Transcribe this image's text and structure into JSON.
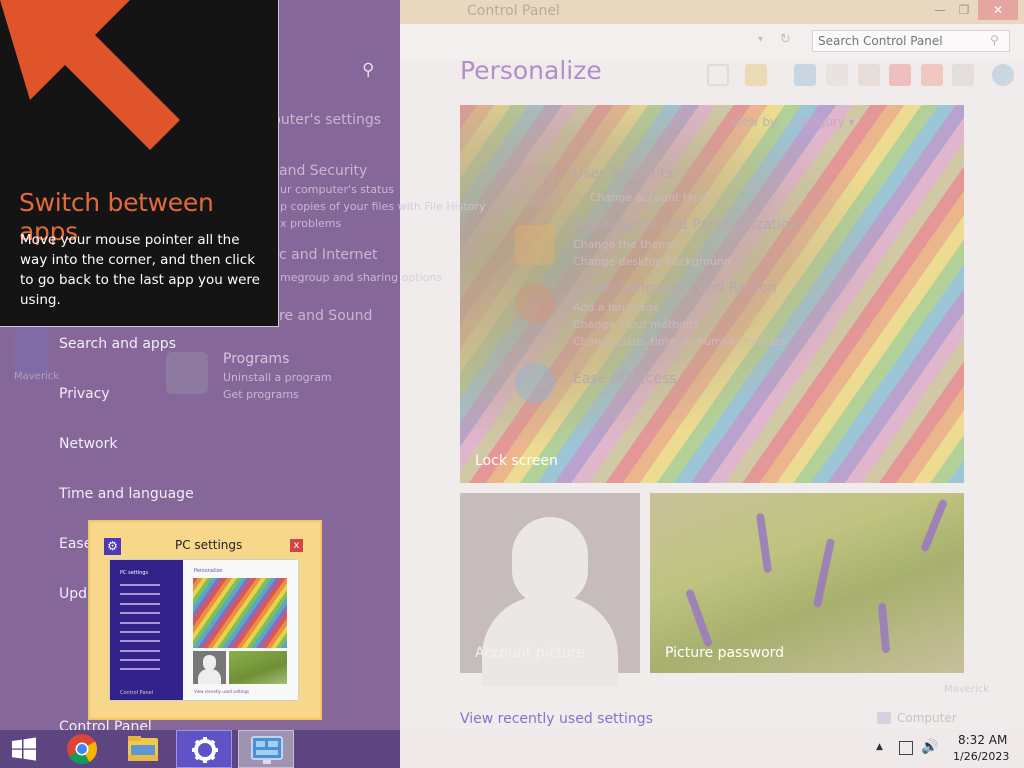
{
  "control_panel": {
    "title": "Control Panel",
    "min_label": "—",
    "max_label": "❐",
    "close_label": "✕",
    "search_placeholder": "Search Control Panel",
    "view_by_label": "View by:",
    "view_by_value": "Category ▾",
    "categories": [
      {
        "title": "User Accounts",
        "subs": [
          "Change account type"
        ]
      },
      {
        "title": "Appearance and Personalization",
        "subs": [
          "Change the theme",
          "Change desktop background"
        ]
      },
      {
        "title": "Clock, Language, and Region",
        "subs": [
          "Add a language",
          "Change input methods",
          "Change date, time, or number formats"
        ]
      },
      {
        "title": "Ease of Access",
        "subs": []
      }
    ],
    "left_categories": [
      {
        "title": "puter's settings"
      },
      {
        "title": "and Security",
        "subs": [
          "ur computer's status",
          "p copies of your files with File History",
          "x problems"
        ]
      },
      {
        "title": "c and Internet",
        "subs": [
          "megroup and sharing options"
        ]
      },
      {
        "title": "re and Sound"
      },
      {
        "title": "Programs",
        "subs": [
          "Uninstall a program",
          "Get programs"
        ]
      }
    ],
    "computer_label": "Computer",
    "watermark": "Maverick"
  },
  "personalize": {
    "title": "Personalize",
    "lock_screen_label": "Lock screen",
    "account_picture_label": "Account picture",
    "picture_password_label": "Picture password",
    "recent_link": "View recently used settings"
  },
  "pc_settings": {
    "items": [
      "Search and apps",
      "Privacy",
      "Network",
      "Time and language",
      "Ease",
      "Upd"
    ],
    "footer_label": "Control Panel",
    "ghost_label": "Maverick"
  },
  "tip": {
    "title": "Switch between apps",
    "body": "Move your mouse pointer all the way into the corner, and then click to go back to the last app you were using."
  },
  "thumbnail": {
    "title": "PC settings",
    "close": "x",
    "side_title": "PC settings",
    "side_footer": "Control Panel",
    "main_title": "Personalize",
    "link": "View recently used settings"
  },
  "taskbar": {
    "time": "8:32 AM",
    "date": "1/26/2023",
    "apps": [
      "start-icon",
      "chrome-icon",
      "file-explorer-icon",
      "pc-settings-icon",
      "control-panel-icon"
    ]
  },
  "colors": {
    "accent": "#85679a",
    "tip_title": "#e06a3a",
    "link": "#8b6fcc"
  }
}
